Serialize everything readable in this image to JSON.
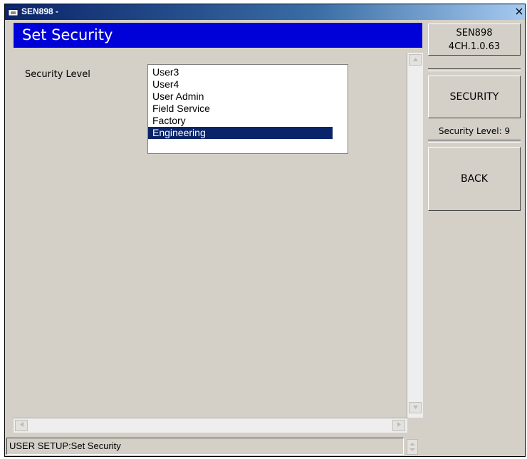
{
  "window": {
    "title": "SEN898 -",
    "close_glyph": "×"
  },
  "banner": {
    "title": "Set Security"
  },
  "security_level_label": "Security Level",
  "listbox": {
    "items": [
      "User3",
      "User4",
      "User Admin",
      "Field Service",
      "Factory",
      "Engineering"
    ],
    "selected": "Engineering"
  },
  "status": {
    "text": "USER SETUP:Set Security"
  },
  "right_panel": {
    "version_line1": "SEN898",
    "version_line2": "4CH.1.0.63",
    "security_button": "SECURITY",
    "security_level": "Security Level: 9",
    "back_button": "BACK"
  },
  "colors": {
    "banner": "#0000d8",
    "titlebar": "#0a246a",
    "selection": "#0a246a",
    "face": "#d4d0c8"
  },
  "icons": {
    "app": "app-window-icon",
    "close": "close-icon",
    "scroll_up": "triangle-up",
    "scroll_down": "triangle-down",
    "scroll_left": "triangle-left",
    "scroll_right": "triangle-right"
  }
}
